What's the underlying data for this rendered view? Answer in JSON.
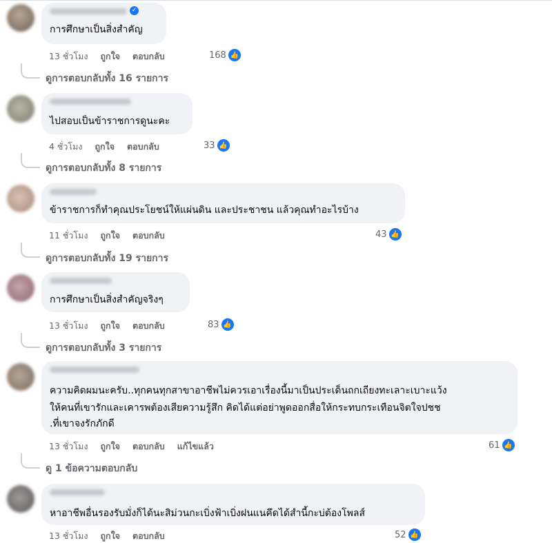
{
  "comments": [
    {
      "text_lines": [
        "การศึกษาเป็นสิ่งสำคัญ"
      ],
      "time": "13 ชั่วโมง",
      "like": "ถูกใจ",
      "reply": "ตอบกลับ",
      "edited": "",
      "reactions": "168",
      "replies_link": "ดูการตอบกลับทั้ง 16 รายการ",
      "verified": true
    },
    {
      "text_lines": [
        "ไปสอบเป็นข้าราชการดูนะคะ"
      ],
      "time": "4 ชั่วโมง",
      "like": "ถูกใจ",
      "reply": "ตอบกลับ",
      "edited": "",
      "reactions": "33",
      "replies_link": "ดูการตอบกลับทั้ง 8 รายการ",
      "verified": false
    },
    {
      "text_lines": [
        "ข้าราชการก็ทำคุณประโยชน์ให้แผ่นดิน และประชาชน แล้วคุณทำอะไรบ้าง"
      ],
      "time": "11 ชั่วโมง",
      "like": "ถูกใจ",
      "reply": "ตอบกลับ",
      "edited": "",
      "reactions": "43",
      "replies_link": "ดูการตอบกลับทั้ง 19 รายการ",
      "verified": false
    },
    {
      "text_lines": [
        "การศึกษาเป็นสิ่งสำคัญจริงๆ"
      ],
      "time": "13 ชั่วโมง",
      "like": "ถูกใจ",
      "reply": "ตอบกลับ",
      "edited": "",
      "reactions": "83",
      "replies_link": "ดูการตอบกลับทั้ง 3 รายการ",
      "verified": false
    },
    {
      "text_lines": [
        "ความคิดผมนะครับ..ทุกคนทุกสาขาอาชีพไม่ควรเอาเรื่องนี้มาเป็นประเด็นถกเถียงทะเลาะเบาะแว้ง",
        "ให้คนที่เขารักและเคารพต้องเสียความรู้สึก คิดได้แต่อย่าพูดออกสื่อให้กระทบกระเทือนจิตใจปชช",
        ".ที่เขาจงรักภักดี"
      ],
      "time": "13 ชั่วโมง",
      "like": "ถูกใจ",
      "reply": "ตอบกลับ",
      "edited": "แก้ไขแล้ว",
      "reactions": "61",
      "replies_link": "ดู 1 ข้อความตอบกลับ",
      "verified": false
    },
    {
      "text_lines": [
        "หาอาชีพอื่นรองรับมั่งก็ได้นะสิม่วนกะเบิ่งฟ้าเบิ่งฝนแนคึดได้สำนี้กะบ่ต้องโพลส์"
      ],
      "time": "13 ชั่วโมง",
      "like": "ถูกใจ",
      "reply": "ตอบกลับ",
      "edited": "",
      "reactions": "52",
      "replies_link": "",
      "verified": false
    }
  ],
  "icons": {
    "like": "thumbs-up-icon",
    "verified": "verified-badge-icon"
  },
  "colors": {
    "bubble": "#f0f2f5",
    "accent": "#1877f2",
    "muted": "#65676b"
  }
}
